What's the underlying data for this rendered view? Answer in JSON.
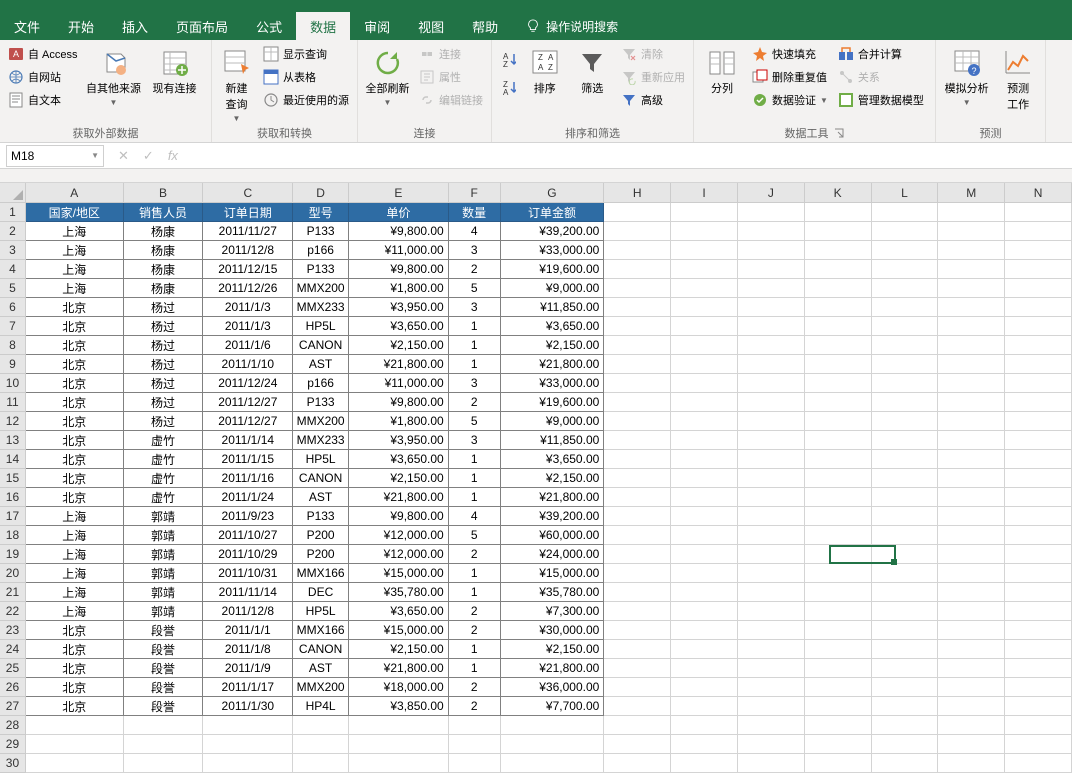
{
  "tabs": [
    "文件",
    "开始",
    "插入",
    "页面布局",
    "公式",
    "数据",
    "审阅",
    "视图",
    "帮助"
  ],
  "active_tab_index": 5,
  "tell_me": "操作说明搜索",
  "namebox": "M18",
  "ribbon": {
    "g1": {
      "access": "自 Access",
      "web": "自网站",
      "text": "自文本",
      "other": "自其他来源",
      "existing": "现有连接",
      "label": "获取外部数据"
    },
    "g2": {
      "newquery": "新建\n查询",
      "showq": "显示查询",
      "fromtable": "从表格",
      "recent": "最近使用的源",
      "label": "获取和转换"
    },
    "g3": {
      "refresh": "全部刷新",
      "conn": "连接",
      "prop": "属性",
      "editlinks": "编辑链接",
      "label": "连接"
    },
    "g4": {
      "az": "A↓Z",
      "za": "Z↓A",
      "sort": "排序",
      "filter": "筛选",
      "clear": "清除",
      "reapply": "重新应用",
      "adv": "高级",
      "label": "排序和筛选"
    },
    "g5": {
      "split": "分列",
      "flash": "快速填充",
      "dup": "删除重复值",
      "valid": "数据验证",
      "consol": "合并计算",
      "rel": "关系",
      "model": "管理数据模型",
      "label": "数据工具"
    },
    "g6": {
      "whatif": "模拟分析",
      "forecast": "预测\n工作",
      "label": "预测"
    }
  },
  "columns": [
    "A",
    "B",
    "C",
    "D",
    "E",
    "F",
    "G",
    "H",
    "I",
    "J",
    "K",
    "L",
    "M",
    "N"
  ],
  "headers": [
    "国家/地区",
    "销售人员",
    "订单日期",
    "型号",
    "单价",
    "数量",
    "订单金额"
  ],
  "rows": [
    [
      "上海",
      "杨康",
      "2011/11/27",
      "P133",
      "¥9,800.00",
      "4",
      "¥39,200.00"
    ],
    [
      "上海",
      "杨康",
      "2011/12/8",
      "p166",
      "¥11,000.00",
      "3",
      "¥33,000.00"
    ],
    [
      "上海",
      "杨康",
      "2011/12/15",
      "P133",
      "¥9,800.00",
      "2",
      "¥19,600.00"
    ],
    [
      "上海",
      "杨康",
      "2011/12/26",
      "MMX200",
      "¥1,800.00",
      "5",
      "¥9,000.00"
    ],
    [
      "北京",
      "杨过",
      "2011/1/3",
      "MMX233",
      "¥3,950.00",
      "3",
      "¥11,850.00"
    ],
    [
      "北京",
      "杨过",
      "2011/1/3",
      "HP5L",
      "¥3,650.00",
      "1",
      "¥3,650.00"
    ],
    [
      "北京",
      "杨过",
      "2011/1/6",
      "CANON",
      "¥2,150.00",
      "1",
      "¥2,150.00"
    ],
    [
      "北京",
      "杨过",
      "2011/1/10",
      "AST",
      "¥21,800.00",
      "1",
      "¥21,800.00"
    ],
    [
      "北京",
      "杨过",
      "2011/12/24",
      "p166",
      "¥11,000.00",
      "3",
      "¥33,000.00"
    ],
    [
      "北京",
      "杨过",
      "2011/12/27",
      "P133",
      "¥9,800.00",
      "2",
      "¥19,600.00"
    ],
    [
      "北京",
      "杨过",
      "2011/12/27",
      "MMX200",
      "¥1,800.00",
      "5",
      "¥9,000.00"
    ],
    [
      "北京",
      "虚竹",
      "2011/1/14",
      "MMX233",
      "¥3,950.00",
      "3",
      "¥11,850.00"
    ],
    [
      "北京",
      "虚竹",
      "2011/1/15",
      "HP5L",
      "¥3,650.00",
      "1",
      "¥3,650.00"
    ],
    [
      "北京",
      "虚竹",
      "2011/1/16",
      "CANON",
      "¥2,150.00",
      "1",
      "¥2,150.00"
    ],
    [
      "北京",
      "虚竹",
      "2011/1/24",
      "AST",
      "¥21,800.00",
      "1",
      "¥21,800.00"
    ],
    [
      "上海",
      "郭靖",
      "2011/9/23",
      "P133",
      "¥9,800.00",
      "4",
      "¥39,200.00"
    ],
    [
      "上海",
      "郭靖",
      "2011/10/27",
      "P200",
      "¥12,000.00",
      "5",
      "¥60,000.00"
    ],
    [
      "上海",
      "郭靖",
      "2011/10/29",
      "P200",
      "¥12,000.00",
      "2",
      "¥24,000.00"
    ],
    [
      "上海",
      "郭靖",
      "2011/10/31",
      "MMX166",
      "¥15,000.00",
      "1",
      "¥15,000.00"
    ],
    [
      "上海",
      "郭靖",
      "2011/11/14",
      "DEC",
      "¥35,780.00",
      "1",
      "¥35,780.00"
    ],
    [
      "上海",
      "郭靖",
      "2011/12/8",
      "HP5L",
      "¥3,650.00",
      "2",
      "¥7,300.00"
    ],
    [
      "北京",
      "段誉",
      "2011/1/1",
      "MMX166",
      "¥15,000.00",
      "2",
      "¥30,000.00"
    ],
    [
      "北京",
      "段誉",
      "2011/1/8",
      "CANON",
      "¥2,150.00",
      "1",
      "¥2,150.00"
    ],
    [
      "北京",
      "段誉",
      "2011/1/9",
      "AST",
      "¥21,800.00",
      "1",
      "¥21,800.00"
    ],
    [
      "北京",
      "段誉",
      "2011/1/17",
      "MMX200",
      "¥18,000.00",
      "2",
      "¥36,000.00"
    ],
    [
      "北京",
      "段誉",
      "2011/1/30",
      "HP4L",
      "¥3,850.00",
      "2",
      "¥7,700.00"
    ]
  ]
}
